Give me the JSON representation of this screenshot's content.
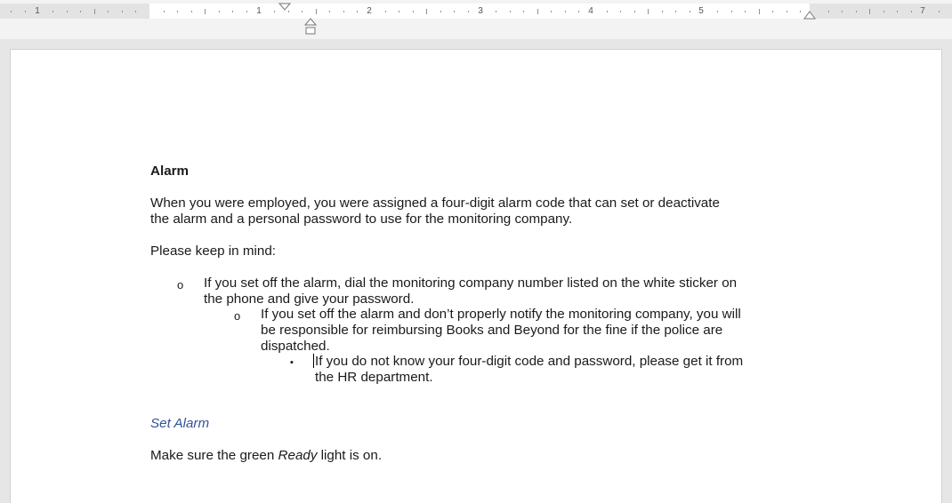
{
  "ruler": {
    "numbers": [
      "1",
      "1",
      "2",
      "3",
      "4",
      "5",
      "7"
    ]
  },
  "document": {
    "heading": "Alarm",
    "intro_line1": "When you were employed, you were assigned a four-digit alarm code that can set or deactivate",
    "intro_line2": "the alarm and a personal password to use for the monitoring company.",
    "keep_in_mind": "Please keep in mind:",
    "list": [
      {
        "bullet": "o",
        "line1": "If you set off the alarm, dial the monitoring company number listed on the white sticker on",
        "line2": "the phone and give your password."
      },
      {
        "bullet": "o",
        "line1": "If you set off the alarm and don’t properly notify the monitoring company, you will",
        "line2": "be responsible for reimbursing Books and Beyond for the fine if the police are",
        "line3": "dispatched."
      },
      {
        "bullet": "▪",
        "line1": "If you do not know your four-digit code and password, please get it from",
        "line2": "the HR department."
      }
    ],
    "set_alarm_heading": "Set Alarm",
    "step1_prefix": "Make sure the green ",
    "step1_italic": "Ready",
    "step1_suffix": " light is on."
  }
}
